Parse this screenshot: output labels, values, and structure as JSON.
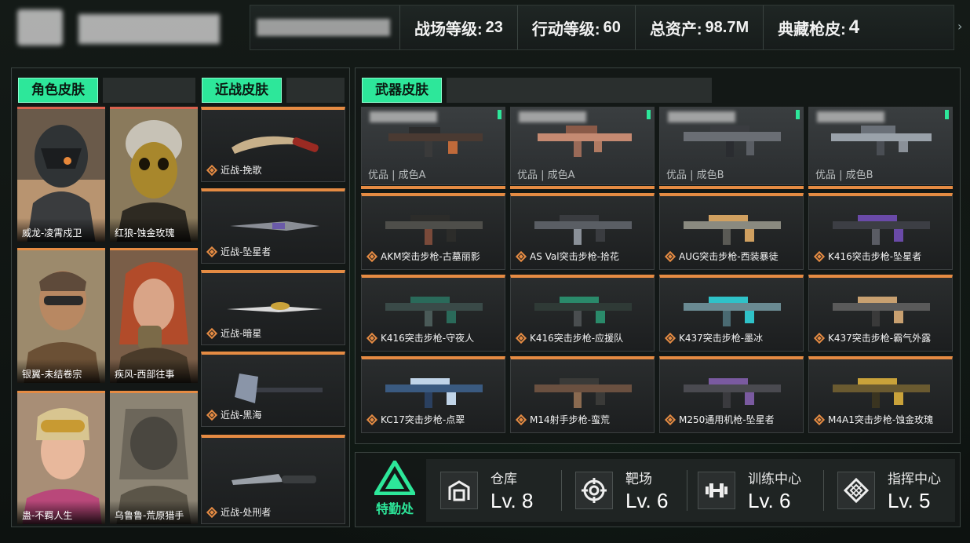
{
  "header": {
    "stats": [
      {
        "label": "战场等级:",
        "value": "23"
      },
      {
        "label": "行动等级:",
        "value": "60"
      },
      {
        "label": "总资产:",
        "value": "98.7M"
      },
      {
        "label": "典藏枪皮:",
        "value": "4"
      }
    ],
    "more_icon": "chevron-right-icon"
  },
  "character_skins": {
    "tab_label": "角色皮肤",
    "items": [
      {
        "label": "威龙-凌霄戍卫"
      },
      {
        "label": "红狼-蚀金玫瑰"
      },
      {
        "label": "银翼-未结卷宗"
      },
      {
        "label": "疾风-西部往事"
      },
      {
        "label": "蛊-不羁人生"
      },
      {
        "label": "乌鲁鲁-荒原猎手"
      }
    ]
  },
  "melee_skins": {
    "tab_label": "近战皮肤",
    "items": [
      {
        "label": "近战-挽歌"
      },
      {
        "label": "近战-坠星者"
      },
      {
        "label": "近战-暗星"
      },
      {
        "label": "近战-黑海"
      },
      {
        "label": "近战-处刑者"
      }
    ]
  },
  "weapon_skins": {
    "tab_label": "武器皮肤",
    "featured": [
      {
        "quality": "优品 | 成色A"
      },
      {
        "quality": "优品 | 成色A"
      },
      {
        "quality": "优品 | 成色B"
      },
      {
        "quality": "优品 | 成色B"
      }
    ],
    "items": [
      {
        "label": "AKM突击步枪-古墓丽影"
      },
      {
        "label": "AS Val突击步枪-拾花"
      },
      {
        "label": "AUG突击步枪-西装暴徒"
      },
      {
        "label": "K416突击步枪-坠星者"
      },
      {
        "label": "K416突击步枪-守夜人"
      },
      {
        "label": "K416突击步枪-应援队"
      },
      {
        "label": "K437突击步枪-墨冰"
      },
      {
        "label": "K437突击步枪-霸气外露"
      },
      {
        "label": "KC17突击步枪-点翠"
      },
      {
        "label": "M14射手步枪-蛮荒"
      },
      {
        "label": "M250通用机枪-坠星者"
      },
      {
        "label": "M4A1突击步枪-蚀金玫瑰"
      }
    ]
  },
  "special_ops": {
    "logo_label": "特勤处",
    "facilities": [
      {
        "name": "仓库",
        "level": "Lv. 8",
        "icon": "warehouse-icon"
      },
      {
        "name": "靶场",
        "level": "Lv. 6",
        "icon": "target-icon"
      },
      {
        "name": "训练中心",
        "level": "Lv. 6",
        "icon": "dumbbell-icon"
      },
      {
        "name": "指挥中心",
        "level": "Lv. 5",
        "icon": "command-icon"
      }
    ]
  },
  "colors": {
    "accent_green": "#2de79a",
    "rarity_orange": "#e58b43",
    "rarity_red": "#d8624e"
  }
}
